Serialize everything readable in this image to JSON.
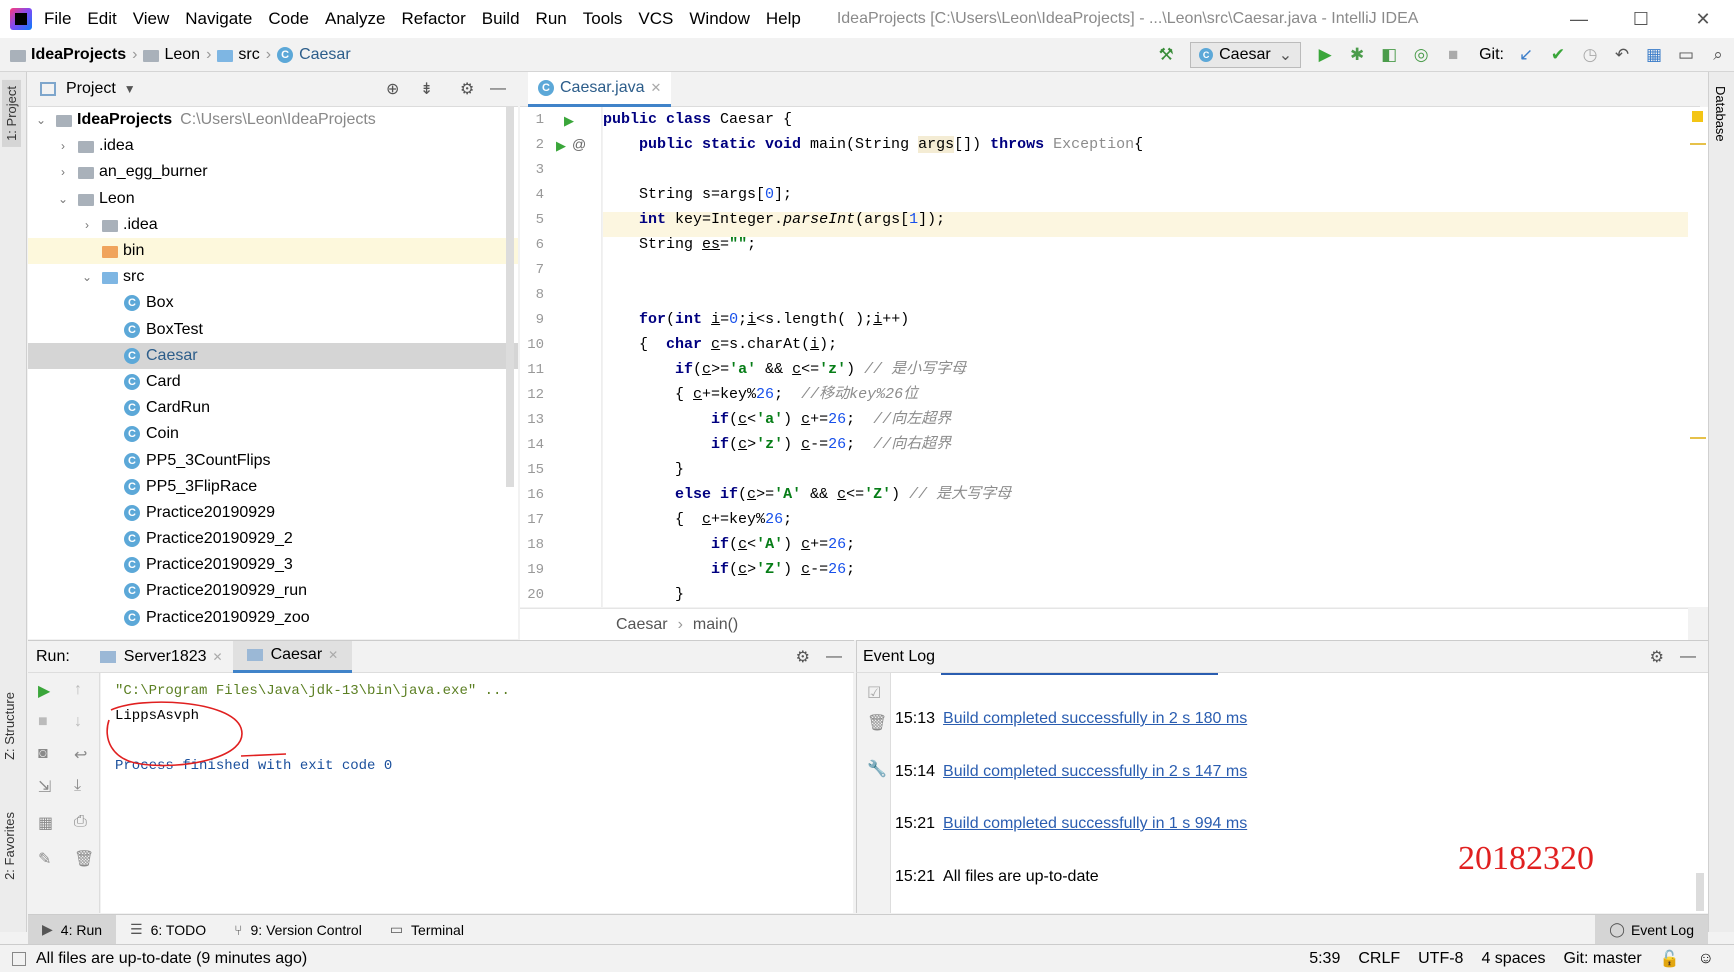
{
  "window": {
    "menu": [
      "File",
      "Edit",
      "View",
      "Navigate",
      "Code",
      "Analyze",
      "Refactor",
      "Build",
      "Run",
      "Tools",
      "VCS",
      "Window",
      "Help"
    ],
    "title": "IdeaProjects [C:\\Users\\Leon\\IdeaProjects] - ...\\Leon\\src\\Caesar.java - IntelliJ IDEA"
  },
  "navbar": {
    "crumbs": [
      "IdeaProjects",
      "Leon",
      "src",
      "Caesar"
    ],
    "run_config": "Caesar",
    "git_label": "Git:"
  },
  "stripes": {
    "left_top": "1: Project",
    "left_structure": "Z: Structure",
    "left_favorites": "2: Favorites",
    "right_database": "Database"
  },
  "project": {
    "header": "Project",
    "root_name": "IdeaProjects",
    "root_path": "C:\\Users\\Leon\\IdeaProjects",
    "items": [
      {
        "label": ".idea"
      },
      {
        "label": "an_egg_burner"
      },
      {
        "label": "Leon"
      },
      {
        "label": ".idea"
      },
      {
        "label": "bin"
      },
      {
        "label": "src"
      },
      {
        "label": "Box"
      },
      {
        "label": "BoxTest"
      },
      {
        "label": "Caesar"
      },
      {
        "label": "Card"
      },
      {
        "label": "CardRun"
      },
      {
        "label": "Coin"
      },
      {
        "label": "PP5_3CountFlips"
      },
      {
        "label": "PP5_3FlipRace"
      },
      {
        "label": "Practice20190929"
      },
      {
        "label": "Practice20190929_2"
      },
      {
        "label": "Practice20190929_3"
      },
      {
        "label": "Practice20190929_run"
      },
      {
        "label": "Practice20190929_zoo"
      }
    ]
  },
  "editor": {
    "tab": "Caesar.java",
    "line_numbers": [
      "1",
      "2",
      "3",
      "4",
      "5",
      "6",
      "7",
      "8",
      "9",
      "10",
      "11",
      "12",
      "13",
      "14",
      "15",
      "16",
      "17",
      "18",
      "19",
      "20"
    ],
    "breadcrumb_class": "Caesar",
    "breadcrumb_method": "main()"
  },
  "run": {
    "label": "Run:",
    "tabs": [
      "Server1823",
      "Caesar"
    ],
    "console": [
      "\"C:\\Program Files\\Java\\jdk-13\\bin\\java.exe\" ...",
      "LippsAsvph",
      "",
      "Process finished with exit code 0"
    ]
  },
  "event_log": {
    "title": "Event Log",
    "entries": [
      {
        "time": "15:13",
        "text": "Build completed successfully in 2 s 180 ms"
      },
      {
        "time": "15:14",
        "text": "Build completed successfully in 2 s 147 ms"
      },
      {
        "time": "15:21",
        "text": "Build completed successfully in 1 s 994 ms"
      },
      {
        "time": "15:21",
        "text": "All files are up-to-date"
      }
    ],
    "stamp": "20182320"
  },
  "bottom_tabs": [
    "4: Run",
    "6: TODO",
    "9: Version Control",
    "Terminal"
  ],
  "bottom_right_tab": "Event Log",
  "status": {
    "message": "All files are up-to-date (9 minutes ago)",
    "position": "5:39",
    "line_sep": "CRLF",
    "encoding": "UTF-8",
    "indent": "4 spaces",
    "git": "Git: master"
  },
  "colors": {
    "accent": "#4083c9",
    "link": "#2a5db0",
    "stamp": "#e02020",
    "keyword": "#000080",
    "string": "#067d17"
  }
}
